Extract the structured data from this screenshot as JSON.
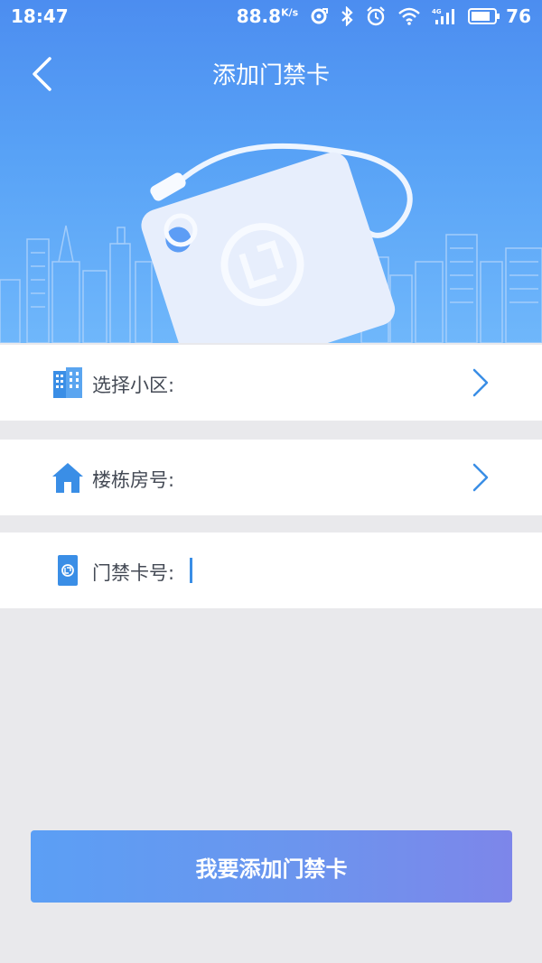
{
  "status_bar": {
    "time": "18:47",
    "net_speed": "88.8",
    "net_unit": "K/s",
    "battery": "76",
    "icons": [
      "sync-icon",
      "bluetooth-icon",
      "alarm-icon",
      "wifi-icon",
      "signal-4g-icon",
      "battery-icon"
    ]
  },
  "nav": {
    "title": "添加门禁卡",
    "back_icon": "chevron-left-icon"
  },
  "form": {
    "community_label": "选择小区:",
    "building_label": "楼栋房号:",
    "card_label": "门禁卡号:",
    "card_value": ""
  },
  "submit": {
    "label": "我要添加门禁卡"
  },
  "colors": {
    "header_gradient_top": "#4c8df0",
    "header_gradient_bottom": "#6fb7fb",
    "icon_blue": "#3a8ee6",
    "button_start": "#5b9ff5",
    "button_end": "#7d86ea",
    "background": "#e9e9ec"
  }
}
